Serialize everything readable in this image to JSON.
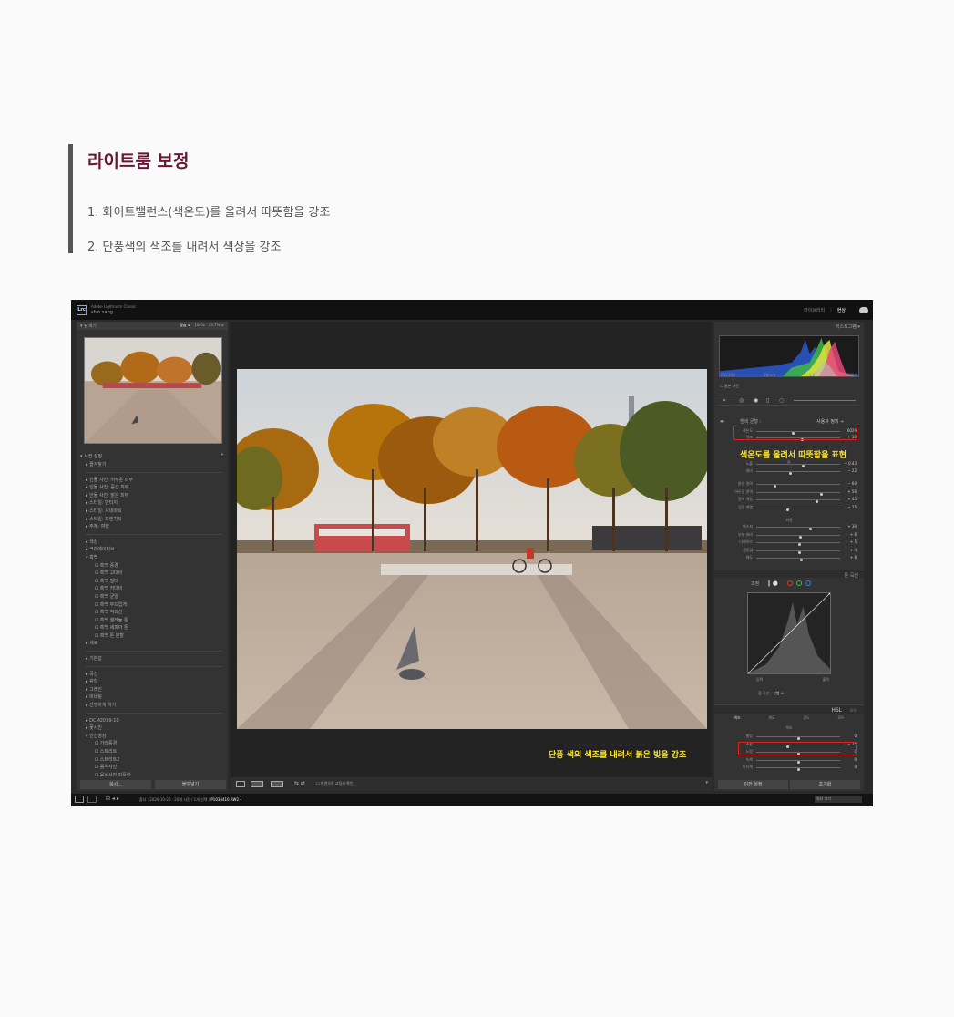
{
  "post": {
    "title": "라이트룸 보정",
    "line1": "1. 화이트밸런스(색온도)를 올려서 따뜻함을 강조",
    "line2": "2. 단풍색의 색조를 내려서 색상을 강조"
  },
  "lightroom": {
    "logo": "Lrc",
    "app_name": "Adobe Lightroom Classic",
    "user": "shin sang",
    "modules": [
      "라이브러리",
      "현상"
    ],
    "active_module": "현상",
    "left_panel": {
      "navigator": "탐색기",
      "zoom": [
        "맞춤 ≑",
        "100%",
        "33.7% ≑"
      ],
      "presets_title": "사전 설정",
      "presets": [
        {
          "label": "▸ 즐겨찾기",
          "child": false
        },
        {
          "label": "",
          "sep": true
        },
        {
          "label": "▸ 인물 사진: 어두운 피부",
          "child": false
        },
        {
          "label": "▸ 인물 사진: 중간 피부",
          "child": false
        },
        {
          "label": "▸ 인물 사진: 밝은 피부",
          "child": false
        },
        {
          "label": "▸ 스타일: 빈티지",
          "child": false
        },
        {
          "label": "▸ 스타일: 시네마틱",
          "child": false
        },
        {
          "label": "▸ 스타일: 프렌치틱",
          "child": false
        },
        {
          "label": "▸ 주제: 여행",
          "child": false
        },
        {
          "label": "",
          "sep": true
        },
        {
          "label": "▸ 색상",
          "child": false
        },
        {
          "label": "▸ 크리에이티브",
          "child": false
        },
        {
          "label": "▾ 흑백",
          "child": false
        },
        {
          "label": "⊡ 흑백 풍경",
          "child": true
        },
        {
          "label": "⊡ 흑백 고대비",
          "child": true
        },
        {
          "label": "⊡ 흑백 필터",
          "child": true
        },
        {
          "label": "⊡ 흑백 카더비",
          "child": true
        },
        {
          "label": "⊡ 흑백 균일",
          "child": true
        },
        {
          "label": "⊡ 흑백 부드럽게",
          "child": true
        },
        {
          "label": "⊡ 흑백 적외선",
          "child": true
        },
        {
          "label": "⊡ 흑백 셀레늄 톤",
          "child": true
        },
        {
          "label": "⊡ 흑백 세피아 톤",
          "child": true
        },
        {
          "label": "⊡ 흑백 톤 분할",
          "child": true
        },
        {
          "label": "▸ 세로",
          "child": false
        },
        {
          "label": "",
          "sep": true
        },
        {
          "label": "▸ 기본값",
          "child": false
        },
        {
          "label": "",
          "sep": true
        },
        {
          "label": "▸ 곡선",
          "child": false
        },
        {
          "label": "▸ 광학",
          "child": false
        },
        {
          "label": "▸ 그레인",
          "child": false
        },
        {
          "label": "▸ 비네팅",
          "child": false
        },
        {
          "label": "▸ 선명하게 하기",
          "child": false
        },
        {
          "label": "",
          "sep": true
        },
        {
          "label": "▸ DCM2019-10",
          "child": false
        },
        {
          "label": "▸ 꽃사진",
          "child": false
        },
        {
          "label": "▾ 인선영상",
          "child": false
        },
        {
          "label": "⊡ 가라풍경",
          "child": true
        },
        {
          "label": "⊡ 스트리트",
          "child": true
        },
        {
          "label": "⊡ 스트리트2",
          "child": true
        },
        {
          "label": "⊡ 음식사진",
          "child": true
        },
        {
          "label": "⊡ 음식사진 따뜻함",
          "child": true
        }
      ],
      "copy_button": "복사...",
      "paste_button": "붙여넣기"
    },
    "right_panel": {
      "histogram": "히스토그램",
      "hist_readout": [
        "ISO 250",
        "28mm",
        "f / 5.6",
        "1/500초"
      ],
      "original_photo": "원본 사진",
      "wb_label": "흰색 균형 :",
      "wb_value": "사용자 정의 ÷",
      "sliders_wb": [
        {
          "label": "색온도",
          "value": "6029",
          "pos": 0.44
        },
        {
          "label": "색조",
          "value": "+ 10",
          "pos": 0.55
        }
      ],
      "tone_head": "톤",
      "tone_auto": "자동",
      "sliders_tone": [
        {
          "label": "노출",
          "value": "+ 0.43",
          "pos": 0.56
        },
        {
          "label": "대비",
          "value": "− 22",
          "pos": 0.41
        }
      ],
      "sliders_tone2": [
        {
          "label": "밝은 영역",
          "value": "− 60",
          "pos": 0.22
        },
        {
          "label": "어두운 영역",
          "value": "+ 56",
          "pos": 0.78
        },
        {
          "label": "흰색 계열",
          "value": "+ 45",
          "pos": 0.72
        },
        {
          "label": "검정 계열",
          "value": "− 25",
          "pos": 0.38
        }
      ],
      "presence_head": "외관",
      "sliders_presence": [
        {
          "label": "텍스처",
          "value": "+ 30",
          "pos": 0.65
        },
        {
          "label": "부분 대비",
          "value": "+ 6",
          "pos": 0.53
        },
        {
          "label": "디헤이즈",
          "value": "+ 5",
          "pos": 0.52
        },
        {
          "label": "생동감",
          "value": "+ 4",
          "pos": 0.52
        },
        {
          "label": "채도",
          "value": "+ 8",
          "pos": 0.54
        }
      ],
      "tone_curve": "톤 곡선",
      "curve_region": "조정",
      "curve_labels": [
        "입력",
        "출력"
      ],
      "point_curve_label": "점 곡선 :",
      "point_curve_value": "선형 ≑",
      "hsl": "HSL",
      "hsl_all": "모두",
      "hsl_tabs": [
        "색조",
        "채도",
        "광도",
        "모두"
      ],
      "hsl_hue": "색조",
      "sliders_hsl": [
        {
          "label": "빨강",
          "value": "0",
          "pos": 0.5
        },
        {
          "label": "주황",
          "value": "− 25",
          "pos": 0.38
        },
        {
          "label": "노랑",
          "value": "0",
          "pos": 0.5
        },
        {
          "label": "녹색",
          "value": "0",
          "pos": 0.5
        },
        {
          "label": "바다색",
          "value": "0",
          "pos": 0.5
        }
      ],
      "prev_button": "이전 설정",
      "reset_button": "초기화"
    },
    "annotation_top": "색온도를 올려서 따뜻함을 표현",
    "annotation_bottom": "단풍 색의 색조를 내려서 붉은 빛을 강조",
    "toolbar": {
      "softproof": "☐ 화면으로 교정쇄 확인"
    },
    "filmstrip": {
      "info_prefix": "폴더 : 2020-10-26 · 20개 사진 / 1개 선택 /",
      "filename": "P1034410.RW2",
      "filter_label": "필터 :",
      "filter_value": "필터 끄기"
    }
  }
}
